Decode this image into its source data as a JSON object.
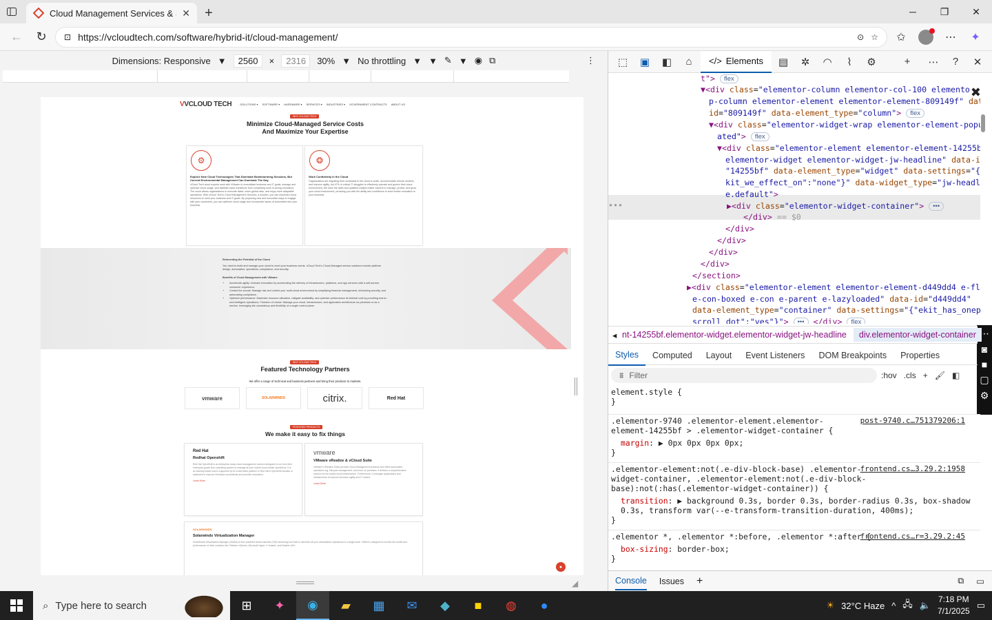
{
  "browser": {
    "tab_title": "Cloud Management Services & Sc",
    "url": "https://vcloudtech.com/software/hybrid-it/cloud-management/"
  },
  "devbar": {
    "dimensions": "Dimensions: Responsive",
    "width": "2560",
    "height": "2316",
    "zoom": "30%",
    "throttle": "No throttling"
  },
  "site": {
    "logo": "VCLOUD TECH",
    "nav": [
      "SOLUTIONS ▾",
      "SOFTWARE ▾",
      "HARDWARE ▾",
      "SERVICES ▾",
      "INDUSTRIES ▾",
      "GOVERNMENT CONTRACTS",
      "ABOUT US"
    ],
    "pill1": "WHY VCLOUD TECH",
    "hero_line1": "Minimize Cloud-Managed Service Costs",
    "hero_line2": "And Maximize Your Expertise",
    "card1_title": "Explore New Cloud Technologies That Dominate Brainstorming Sessions, But Current Environmental Management Can Dominate The Day.",
    "card1_body": "vCloud Tech cloud experts work with VMware to consolidate business and IT goals, manage and optimize cloud usage, and facilitate basic transitions from completing work to strong innovation. The cloud allows organizations to innovate faster, lower global risks, and enjoy more adaptable operations. With vCloud Tech's Cloud Management Services, a solution, you can maximize cloud resources to meet your business and IT goals. By proposing new and innovative ways to engage with your customers, you can optimize cloud usage and incorporate layers of automation into your business.",
    "card2_title": "Work Confidently in the Cloud",
    "card2_body": "Organizations are migrating their workloads to the cloud to scale, accommodate remote workers, and improve agility, but 47% of critical IT struggles to effectively operate and govern their cloud environment. We have the skills and qualified subject matter experts to manage, protect, and grow your cloud environment, providing you with the ability and confidence to drive further innovation in your business.",
    "band_title": "Reinventing the Potential of the Cloud",
    "band_body": "You need to build and manage your cloud to meet your business needs. vCloud Tech's Cloud-Managed service solutions include platform design, automation, operations, compliance, and security.",
    "band_sub": "Benefits of Cloud Management with VMware",
    "bullets": [
      "Accelerate agility: Unleash innovation by accelerating the delivery of infrastructure, platforms, and app services with a self-service consumer experience.",
      "Control the clouds: Manage risk and control your multi-cloud environment by simplifying financial management, enhancing security, and automating compliance.",
      "Optimize performance: Maximize resource utilization, mitigate availability, and optimize performance at minimal cost by providing end-to-end intelligent operations. Freedom of choice: Manage your cloud, infrastructure, and application architecture on-premises or as a service, leveraging the consistency and flexibility of a single control plane."
    ],
    "pill2": "WHY VCLOUD TECH",
    "partners_title": "Featured Technology Partners",
    "partners_sub": "We offer a range of technical and business partners and bring their products to markets.",
    "partners": [
      "vmware",
      "SOLARWINDS",
      "citrix.",
      "Red Hat"
    ],
    "pill3": "FEATURED PRODUCTS",
    "fix_title": "We make it easy to fix things",
    "f1_brand": "Red Hat",
    "f1_title": "Redhat Openshift",
    "f1_body": "Red Hat OpenShift is an enterprise-ready cloud management solution designed to run from their enterprise-grade linux operating system to manage all your hybrid cloud cluster operations. It is an industry leader and is supported by its Kubernetes platform in Red Hat's OpenShift solution is optimized to improve developer productivity and promote innovation.",
    "f2_brand": "vmware",
    "f2_title": "VMware vRealize & vCloud Suite",
    "f2_body": "VMware's vRealize Suite provides Cloud Management products and offers automation, operations log, lifecycle management, and more on premises. It delivers a comprehensive solution for the hybrid cloud infrastructure. Furthermore, it manages applications and infrastructure to improve business agility and IT control.",
    "f3_brand": "SOLARWINDS",
    "f3_title": "Solarwinds Virtualization Manager",
    "f3_body": "SolarWinds Virtualization Manager (VMAN) is their powerful virtual machine (VM) monitoring tool built to minimize all your virtualization operations in a single suite. VMAN is designed to monitor the health and performance of other solutions like VMware vSphere, Microsoft Hyper-V, Nutanix, and Nutanix AHV.",
    "learn_more": "Learn More"
  },
  "devtools": {
    "elements_tab": "Elements",
    "crumb_a": "nt-14255bf.elementor-widget.elementor-widget-jw-headline",
    "crumb_b": "div.elementor-widget-container",
    "style_tabs": [
      "Styles",
      "Computed",
      "Layout",
      "Event Listeners",
      "DOM Breakpoints",
      "Properties"
    ],
    "filter": "Filter",
    "hov": ":hov",
    "cls": ".cls",
    "console_tabs": [
      "Console",
      "Issues"
    ]
  },
  "styles": {
    "r0_sel": "element.style {",
    "r1_sel": ".elementor-9740 .elementor-element.elementor-element-14255bf > .elementor-widget-container {",
    "r1_src": "post-9740.c…751379206:1",
    "r1_prop": "margin",
    "r1_val": "0px 0px 0px 0px;",
    "r2_sel": ".elementor-element:not(.e-div-block-base) .elementor-widget-container, .elementor-element:not(.e-div-block-base):not(:has(.elementor-widget-container)) {",
    "r2_src": "frontend.cs…3.29.2:1958",
    "r2_prop": "transition",
    "r2_val": "background 0.3s, border 0.3s, border-radius 0.3s, box-shadow 0.3s, transform var(--e-transform-transition-duration, 400ms);",
    "r3_sel": ".elementor *, .elementor *:before, .elementor *:after {",
    "r3_src": "frontend.cs…r=3.29.2:45",
    "r3_prop": "box-sizing",
    "r3_val": "border-box;"
  },
  "taskbar": {
    "search": "Type here to search",
    "weather": "32°C  Haze",
    "time": "7:18 PM",
    "date": "7/1/2025"
  }
}
